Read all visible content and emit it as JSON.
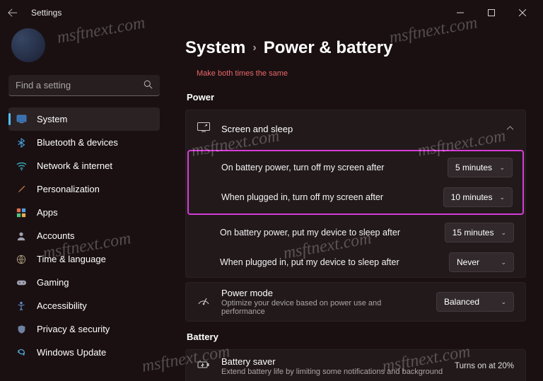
{
  "app": {
    "title": "Settings"
  },
  "search": {
    "placeholder": "Find a setting"
  },
  "nav": {
    "items": [
      {
        "label": "System",
        "icon": "🖥️",
        "active": true
      },
      {
        "label": "Bluetooth & devices",
        "icon": "bt"
      },
      {
        "label": "Network & internet",
        "icon": "net"
      },
      {
        "label": "Personalization",
        "icon": "🖌️"
      },
      {
        "label": "Apps",
        "icon": "apps"
      },
      {
        "label": "Accounts",
        "icon": "👤"
      },
      {
        "label": "Time & language",
        "icon": "🌐"
      },
      {
        "label": "Gaming",
        "icon": "🎮"
      },
      {
        "label": "Accessibility",
        "icon": "acc"
      },
      {
        "label": "Privacy & security",
        "icon": "🛡️"
      },
      {
        "label": "Windows Update",
        "icon": "↻"
      }
    ]
  },
  "breadcrumb": {
    "parent": "System",
    "current": "Power & battery"
  },
  "truncated_link": "Make both times the same",
  "sections": {
    "power": {
      "header": "Power",
      "screen_sleep": {
        "title": "Screen and sleep",
        "rows": [
          {
            "label": "On battery power, turn off my screen after",
            "value": "5 minutes"
          },
          {
            "label": "When plugged in, turn off my screen after",
            "value": "10 minutes"
          },
          {
            "label": "On battery power, put my device to sleep after",
            "value": "15 minutes"
          },
          {
            "label": "When plugged in, put my device to sleep after",
            "value": "Never"
          }
        ]
      },
      "power_mode": {
        "title": "Power mode",
        "subtitle": "Optimize your device based on power use and performance",
        "value": "Balanced"
      }
    },
    "battery": {
      "header": "Battery",
      "saver": {
        "title": "Battery saver",
        "subtitle": "Extend battery life by limiting some notifications and background",
        "status": "Turns on at 20%"
      }
    }
  },
  "watermark": "msftnext.com"
}
